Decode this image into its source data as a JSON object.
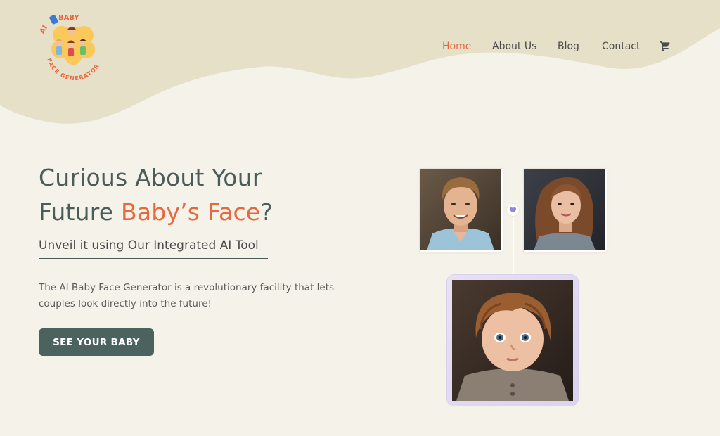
{
  "brand": {
    "logo_top_text": "AI BABY",
    "logo_bottom_text": "FACE GENERATOR"
  },
  "nav": {
    "items": [
      {
        "label": "Home",
        "active": true
      },
      {
        "label": "About Us",
        "active": false
      },
      {
        "label": "Blog",
        "active": false
      },
      {
        "label": "Contact",
        "active": false
      }
    ],
    "cart_icon": "cart-icon"
  },
  "hero": {
    "title_line1": "Curious About Your",
    "title_line2_plain": "Future ",
    "title_line2_accent": "Baby’s Face",
    "title_line2_end": "?",
    "subtitle": "Unveil it using Our Integrated AI Tool",
    "description": "The AI Baby Face Generator is a revolutionary facility that lets couples look directly into the future!",
    "cta_label": "SEE YOUR BABY"
  },
  "colors": {
    "accent": "#e8673c",
    "heading": "#4c5d59",
    "button": "#4c625e",
    "header_wave": "#e6e0c8",
    "background": "#f5f2ea"
  }
}
